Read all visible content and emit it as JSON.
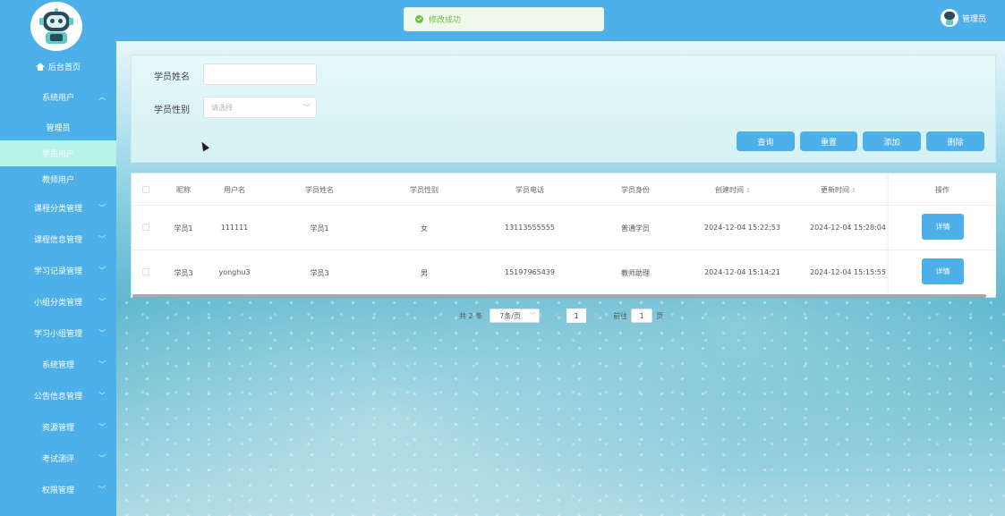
{
  "sidebar": {
    "items": [
      {
        "label": "后台首页",
        "type": "home"
      },
      {
        "label": "系统用户",
        "type": "group",
        "chev": "^"
      },
      {
        "label": "管理员",
        "type": "sub"
      },
      {
        "label": "学员用户",
        "type": "sub-active"
      },
      {
        "label": "教师用户",
        "type": "sub"
      },
      {
        "label": "课程分类管理",
        "type": "group",
        "chev": "v"
      },
      {
        "label": "课程信息管理",
        "type": "group",
        "chev": "v"
      },
      {
        "label": "学习记录管理",
        "type": "group",
        "chev": "v"
      },
      {
        "label": "小组分类管理",
        "type": "group",
        "chev": "v"
      },
      {
        "label": "学习小组管理",
        "type": "group",
        "chev": "v"
      },
      {
        "label": "系统管理",
        "type": "group",
        "chev": "v"
      },
      {
        "label": "公告信息管理",
        "type": "group",
        "chev": "v"
      },
      {
        "label": "资源管理",
        "type": "group",
        "chev": "v"
      },
      {
        "label": "考试测评",
        "type": "group",
        "chev": "v"
      },
      {
        "label": "权限管理",
        "type": "group",
        "chev": "v"
      }
    ]
  },
  "topbar": {
    "toast": "修改成功",
    "user": "管理员"
  },
  "search": {
    "name_label": "学员姓名",
    "name_value": "",
    "gender_label": "学员性别",
    "gender_placeholder": "请选择",
    "buttons": {
      "query": "查询",
      "reset": "重置",
      "add": "添加",
      "delete": "删除"
    }
  },
  "table": {
    "headers": [
      "昵称",
      "用户名",
      "学员姓名",
      "学员性别",
      "学员电话",
      "学员身份",
      "创建时间",
      "更新时间",
      "操作"
    ],
    "rows": [
      {
        "nickname": "学员1",
        "username": "111111",
        "name": "学员1",
        "gender": "女",
        "phone": "13113555555",
        "identity": "普通学员",
        "created": "2024-12-04 15:22:53",
        "updated": "2024-12-04 15:28:04",
        "action": "详情"
      },
      {
        "nickname": "学员3",
        "username": "yonghu3",
        "name": "学员3",
        "gender": "男",
        "phone": "15197965439",
        "identity": "教师助理",
        "created": "2024-12-04 15:14:21",
        "updated": "2024-12-04 15:15:55",
        "action": "详情"
      }
    ]
  },
  "pagination": {
    "total": "共 2 条",
    "page_size": "7条/页",
    "prev": "<",
    "current": "1",
    "next": ">",
    "goto_label": "前往",
    "goto_value": "1",
    "page_unit": "页"
  },
  "colors": {
    "primary": "#4db0e8",
    "active_menu": "#b6f3ea",
    "success": "#67c23a"
  }
}
